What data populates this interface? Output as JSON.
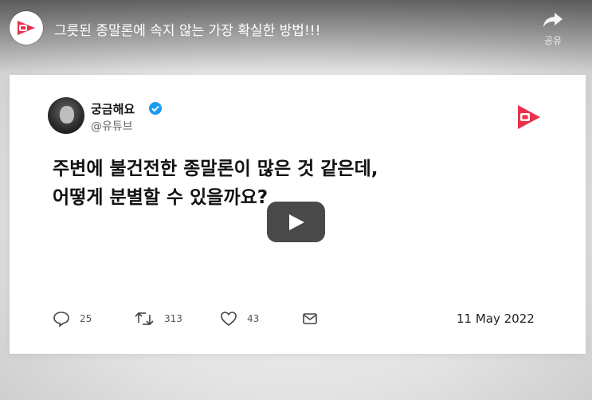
{
  "header": {
    "title": "그릇된 종말론에 속지 않는 가장 확실한 방법!!!",
    "share_label": "공유",
    "channel_icon": "channel-logo-icon"
  },
  "tweet": {
    "display_name": "궁금해요",
    "handle": "@유튜브",
    "verified_icon": "verified-badge-icon",
    "text_line1": "주변에 불건전한 종말론이 많은 것 같은데,",
    "text_line2": "어떻게 분별할 수 있을까요?",
    "replies": "25",
    "retweets": "313",
    "likes": "43",
    "date": "11 May 2022"
  },
  "controls": {
    "play_icon": "play-icon"
  },
  "colors": {
    "brand_red": "#e8314b",
    "verified_blue": "#1d9bf0",
    "play_bg": "#212121"
  }
}
